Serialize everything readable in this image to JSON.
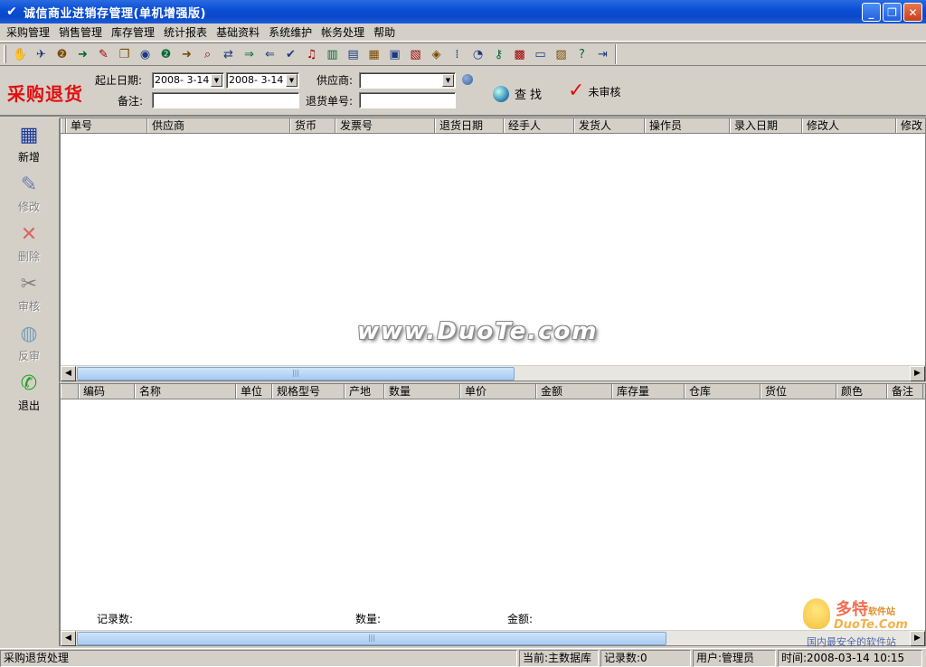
{
  "window": {
    "title": "诚信商业进销存管理(单机增强版)",
    "icon": "app-check-icon",
    "controls": [
      "minimize",
      "restore",
      "close"
    ]
  },
  "menu": [
    "采购管理",
    "销售管理",
    "库存管理",
    "统计报表",
    "基础资料",
    "系统维护",
    "帐务处理",
    "帮助"
  ],
  "toolbar_icons": [
    {
      "name": "handshake-icon",
      "glyph": "✋"
    },
    {
      "name": "runner-icon",
      "glyph": "✈"
    },
    {
      "name": "purchase-order-icon",
      "glyph": "❷"
    },
    {
      "name": "purchase-in-icon",
      "glyph": "➜"
    },
    {
      "name": "edit-doc-icon",
      "glyph": "✎"
    },
    {
      "name": "clipboard-icon",
      "glyph": "❐"
    },
    {
      "name": "money-bag-icon",
      "glyph": "◉"
    },
    {
      "name": "sales-order-icon",
      "glyph": "❷"
    },
    {
      "name": "sales-out-icon",
      "glyph": "➜"
    },
    {
      "name": "inventory-search-icon",
      "glyph": "⌕"
    },
    {
      "name": "transfer-icon",
      "glyph": "⇄"
    },
    {
      "name": "stock-in-icon",
      "glyph": "⇒"
    },
    {
      "name": "stock-out-icon",
      "glyph": "⇐"
    },
    {
      "name": "check-doc-icon",
      "glyph": "✔"
    },
    {
      "name": "bell-icon",
      "glyph": "♫"
    },
    {
      "name": "bar-chart-icon",
      "glyph": "▥"
    },
    {
      "name": "books-icon",
      "glyph": "▤"
    },
    {
      "name": "column-chart-icon",
      "glyph": "▦"
    },
    {
      "name": "org-chart-icon",
      "glyph": "▣"
    },
    {
      "name": "table-icon",
      "glyph": "▧"
    },
    {
      "name": "coins-icon",
      "glyph": "◈"
    },
    {
      "name": "grid-dots-icon",
      "glyph": "⁞"
    },
    {
      "name": "detective-icon",
      "glyph": "◔"
    },
    {
      "name": "key-icon",
      "glyph": "⚷"
    },
    {
      "name": "calculator-icon",
      "glyph": "▩"
    },
    {
      "name": "monitor-icon",
      "glyph": "▭"
    },
    {
      "name": "calendar-icon",
      "glyph": "▨"
    },
    {
      "name": "help-question-icon",
      "glyph": "?"
    },
    {
      "name": "exit-door-icon",
      "glyph": "⇥"
    }
  ],
  "filter": {
    "page_title": "采购退货",
    "date_label": "起止日期:",
    "date_from": "2008- 3-14",
    "date_to": "2008- 3-14",
    "supplier_label": "供应商:",
    "supplier_value": "",
    "note_label": "备注:",
    "note_value": "",
    "return_no_label": "退货单号:",
    "return_no_value": "",
    "find_label": "查找",
    "unaudited_label": "未审核"
  },
  "sidebar": [
    {
      "name": "sidebar-new-button",
      "icon": "new-form-icon",
      "glyph": "▦",
      "label": "新增",
      "enabled": true,
      "color": "#1a3a9a"
    },
    {
      "name": "sidebar-edit-button",
      "icon": "edit-pen-icon",
      "glyph": "✎",
      "label": "修改",
      "enabled": false,
      "color": "#1a3a9a"
    },
    {
      "name": "sidebar-delete-button",
      "icon": "delete-x-icon",
      "glyph": "✕",
      "label": "删除",
      "enabled": false,
      "color": "#e01010"
    },
    {
      "name": "sidebar-audit-button",
      "icon": "tools-icon",
      "glyph": "✂",
      "label": "审核",
      "enabled": false,
      "color": "#404040"
    },
    {
      "name": "sidebar-cancel-audit-button",
      "icon": "globe-search-icon",
      "glyph": "◍",
      "label": "反审",
      "enabled": false,
      "color": "#2a7ab0"
    },
    {
      "name": "sidebar-exit-button",
      "icon": "phone-exit-icon",
      "glyph": "✆",
      "label": "退出",
      "enabled": true,
      "color": "#20a020"
    }
  ],
  "top_grid": {
    "columns": [
      "单号",
      "供应商",
      "货币",
      "发票号",
      "退货日期",
      "经手人",
      "发货人",
      "操作员",
      "录入日期",
      "修改人",
      "修改"
    ]
  },
  "bottom_grid": {
    "columns": [
      "编码",
      "名称",
      "单位",
      "规格型号",
      "产地",
      "数量",
      "单价",
      "金额",
      "库存量",
      "仓库",
      "货位",
      "颜色",
      "备注"
    ],
    "summary": {
      "records_label": "记录数:",
      "qty_label": "数量:",
      "amount_label": "金额:"
    }
  },
  "watermark": "www.DuoTe.com",
  "corner_logo": {
    "brand": "多特",
    "brand_small": "软件站",
    "site": "DuoTe.Com",
    "slogan": "国内最安全的软件站"
  },
  "statusbar": {
    "module": "采购退货处理",
    "database": "当前:主数据库",
    "records": "记录数:0",
    "user": "用户:管理员",
    "time": "时间:2008-03-14  10:15"
  }
}
